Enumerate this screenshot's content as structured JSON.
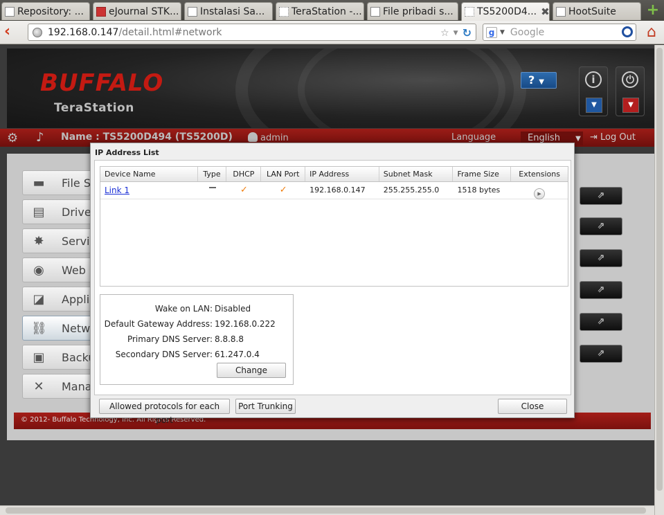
{
  "browser": {
    "tabs": [
      {
        "label": "Repository: ..."
      },
      {
        "label": "eJournal STK..."
      },
      {
        "label": "Instalasi Sa..."
      },
      {
        "label": "TeraStation -..."
      },
      {
        "label": "File pribadi s..."
      },
      {
        "label": "TS5200D4..."
      },
      {
        "label": "HootSuite"
      }
    ],
    "url_host": "192.168.0.147",
    "url_path": "/detail.html#network",
    "search_placeholder": "Google"
  },
  "header": {
    "logo": "BUFFALO",
    "product": "TeraStation",
    "help_label": "?"
  },
  "topbar": {
    "name_info": "Name : TS5200D494 (TS5200D)",
    "user": "admin",
    "language_label": "Language",
    "language_value": "English",
    "logout_label": "Log Out"
  },
  "menu": {
    "items": [
      {
        "label": "File Sh"
      },
      {
        "label": "Drives"
      },
      {
        "label": "Servic"
      },
      {
        "label": "Web S"
      },
      {
        "label": "Applic"
      },
      {
        "label": "Netwo"
      },
      {
        "label": "Backu"
      },
      {
        "label": "Manag"
      }
    ]
  },
  "footer": {
    "copyright": "© 2012- Buffalo Technology, Inc. All Rights Reserved."
  },
  "dialog": {
    "title": "IP Address List",
    "columns": {
      "device_name": "Device Name",
      "type": "Type",
      "dhcp": "DHCP",
      "lan_port": "LAN Port",
      "ip_address": "IP Address",
      "subnet_mask": "Subnet Mask",
      "frame_size": "Frame Size",
      "extensions": "Extensions"
    },
    "rows": [
      {
        "device_name": "Link 1",
        "type": "—",
        "dhcp": "✓",
        "lan_port": "✓",
        "ip_address": "192.168.0.147",
        "subnet_mask": "255.255.255.0",
        "frame_size": "1518 bytes"
      }
    ],
    "settings": {
      "wake_on_lan_label": "Wake on LAN:",
      "wake_on_lan_value": "Disabled",
      "gateway_label": "Default Gateway Address:",
      "gateway_value": "192.168.0.222",
      "primary_dns_label": "Primary DNS Server:",
      "primary_dns_value": "8.8.8.8",
      "secondary_dns_label": "Secondary DNS Server:",
      "secondary_dns_value": "61.247.0.4",
      "change_label": "Change"
    },
    "buttons": {
      "allowed_protocols": "Allowed protocols for each port",
      "port_trunking": "Port Trunking",
      "close": "Close"
    }
  },
  "colors": {
    "accent_red": "#9b1c17",
    "check_orange": "#f07d0c",
    "link_blue": "#1a2fd6"
  }
}
